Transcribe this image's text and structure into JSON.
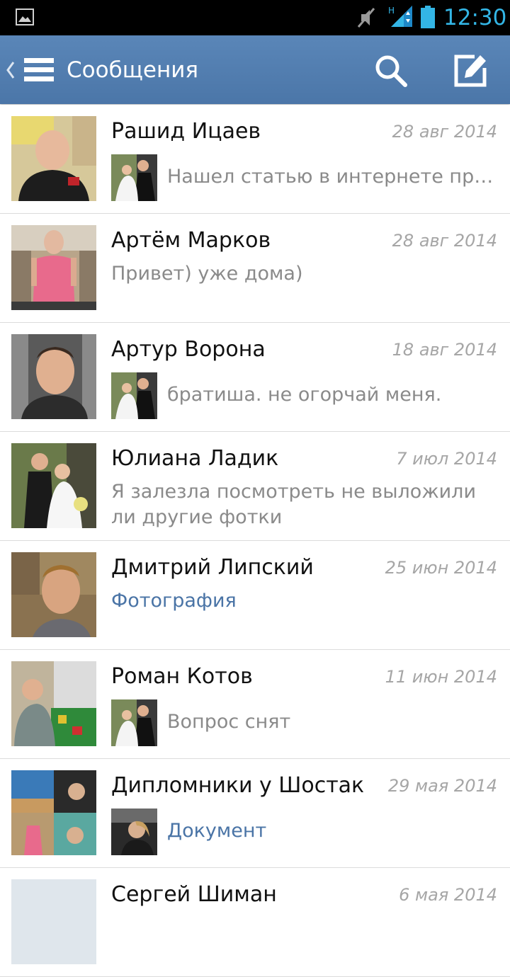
{
  "status_bar": {
    "time": "12:30",
    "network_label": "H",
    "icons": [
      "gallery-icon",
      "mute-icon",
      "signal-icon",
      "battery-icon"
    ],
    "time_color": "#33b5e5"
  },
  "action_bar": {
    "title": "Сообщения",
    "icons": [
      "back-icon",
      "menu-icon",
      "search-icon",
      "compose-icon"
    ],
    "color": "#4f7bae"
  },
  "messages": [
    {
      "name": "Рашид Ицаев",
      "date": "28 авг 2014",
      "text": "Нашел статью в интернете про компоненты",
      "own_reply": true,
      "type": "text"
    },
    {
      "name": "Артём Марков",
      "date": "28 авг 2014",
      "text": "Привет) уже дома)",
      "own_reply": false,
      "type": "text"
    },
    {
      "name": "Артур Ворона",
      "date": "18 авг 2014",
      "text": "братиша. не огорчай меня.",
      "own_reply": true,
      "type": "text"
    },
    {
      "name": "Юлиана Ладик",
      "date": "7 июл 2014",
      "text": "Я залезла посмотреть не выложили ли другие фотки",
      "own_reply": false,
      "type": "text"
    },
    {
      "name": "Дмитрий Липский",
      "date": "25 июн 2014",
      "text": "Фотография",
      "own_reply": false,
      "type": "attachment"
    },
    {
      "name": "Роман Котов",
      "date": "11 июн 2014",
      "text": "Вопрос снят",
      "own_reply": true,
      "type": "text"
    },
    {
      "name": "Дипломники у Шостак",
      "date": "29 мая 2014",
      "text": "Документ",
      "own_reply": true,
      "type": "attachment"
    },
    {
      "name": "Сергей Шиман",
      "date": "6 мая 2014",
      "text": "",
      "own_reply": false,
      "type": "text"
    }
  ],
  "colors": {
    "link": "#4a74a6",
    "date": "#a6a6a6",
    "preview": "#8a8a8a"
  }
}
